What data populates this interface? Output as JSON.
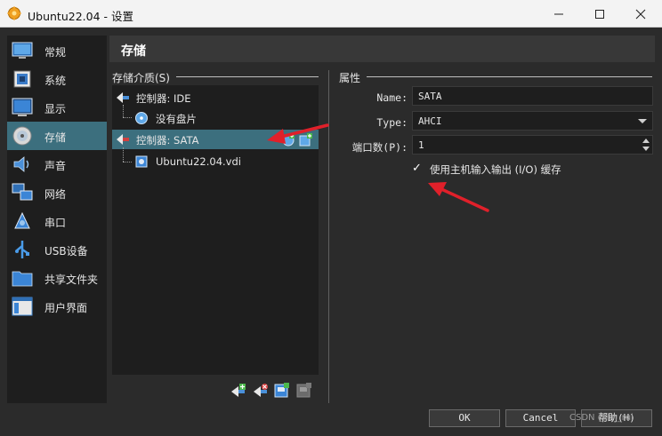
{
  "window": {
    "title": "Ubuntu22.04 - 设置"
  },
  "nav": {
    "items": [
      {
        "label": "常规",
        "icon": "monitor-icon"
      },
      {
        "label": "系统",
        "icon": "chip-icon"
      },
      {
        "label": "显示",
        "icon": "display-icon"
      },
      {
        "label": "存储",
        "icon": "disk-icon",
        "active": true
      },
      {
        "label": "声音",
        "icon": "speaker-icon"
      },
      {
        "label": "网络",
        "icon": "network-icon"
      },
      {
        "label": "串口",
        "icon": "serial-port-icon"
      },
      {
        "label": "USB设备",
        "icon": "usb-icon"
      },
      {
        "label": "共享文件夹",
        "icon": "folder-icon"
      },
      {
        "label": "用户界面",
        "icon": "ui-icon"
      }
    ]
  },
  "panel": {
    "title": "存储"
  },
  "storage": {
    "group_label": "存储介质(S)",
    "tree": [
      {
        "label": "控制器: IDE",
        "type": "controller"
      },
      {
        "label": "没有盘片",
        "type": "optical"
      },
      {
        "label": "控制器: SATA",
        "type": "controller",
        "selected": true
      },
      {
        "label": "Ubuntu22.04.vdi",
        "type": "disk"
      }
    ]
  },
  "attributes": {
    "group_label": "属性",
    "name_label": "Name:",
    "name_value": "SATA",
    "type_label": "Type:",
    "type_value": "AHCI",
    "ports_label": "端口数(P):",
    "ports_value": "1",
    "cache_label": "使用主机输入输出 (I/O) 缓存",
    "cache_checked": true
  },
  "buttons": {
    "ok": "OK",
    "cancel": "Cancel",
    "help": "帮助(H)"
  },
  "watermark": "CSDN @lin_rui",
  "colors": {
    "accent": "#3c6f7e",
    "annotation_arrow": "#e0202a"
  }
}
